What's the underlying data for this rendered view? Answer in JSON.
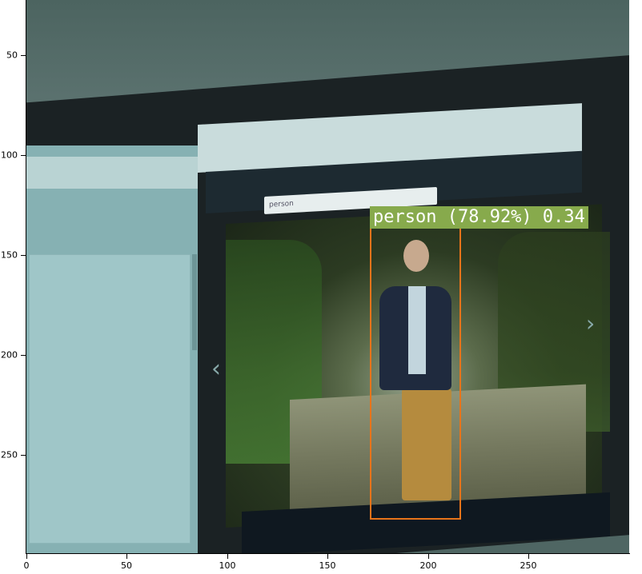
{
  "axes": {
    "y_ticks": [
      "50",
      "100",
      "150",
      "200",
      "250"
    ],
    "x_ticks": [
      "0",
      "50",
      "100",
      "150",
      "200",
      "250"
    ]
  },
  "detection": {
    "label": "person (78.92%) 0.34",
    "box_color": "#e8741a",
    "label_bg": "#87aa4c"
  },
  "screen": {
    "search_text": "person"
  }
}
